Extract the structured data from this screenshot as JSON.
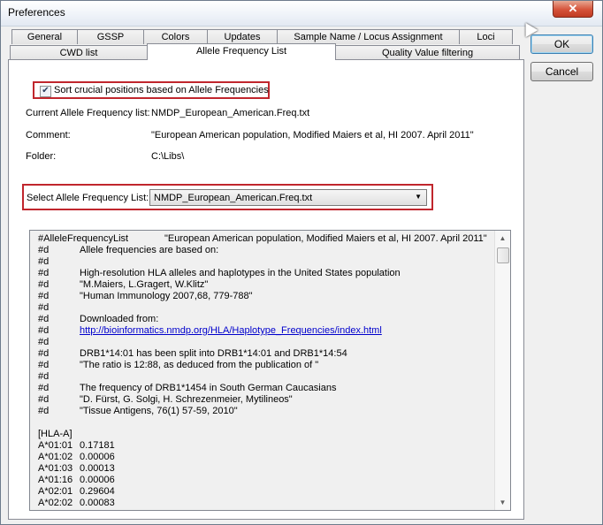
{
  "window": {
    "title": "Preferences",
    "close_glyph": "✕"
  },
  "tabs_row1": [
    "General",
    "GSSP",
    "Colors",
    "Updates",
    "Sample Name / Locus Assignment",
    "Loci"
  ],
  "tabs_row2": [
    "CWD list",
    "Allele Frequency List",
    "Quality Value filtering"
  ],
  "active_tab": "Allele Frequency List",
  "checkbox": {
    "label": "Sort crucial positions based on Allele Frequencies",
    "checked": true,
    "mark": "✔"
  },
  "info": {
    "current_label": "Current Allele Frequency list:",
    "current_value": "NMDP_European_American.Freq.txt",
    "comment_label": "Comment:",
    "comment_value": "\"European American population, Modified Maiers et al, HI 2007. April 2011\"",
    "folder_label": "Folder:",
    "folder_value": "C:\\Libs\\"
  },
  "select": {
    "label": "Select Allele Frequency List:",
    "value": "NMDP_European_American.Freq.txt",
    "arrow": "▼"
  },
  "file_lines": [
    {
      "c1": "#AlleleFrequencyList",
      "c2": "",
      "c3": "\"European American population, Modified Maiers et al, HI 2007. April 2011\""
    },
    {
      "c1": "#d",
      "c2": "Allele frequencies are based on:",
      "c3": ""
    },
    {
      "c1": "#d",
      "c2": "",
      "c3": ""
    },
    {
      "c1": "#d",
      "c2": "High-resolution HLA alleles and haplotypes in the United States population",
      "c3": ""
    },
    {
      "c1": "#d",
      "c2": "\"M.Maiers, L.Gragert, W.Klitz\"",
      "c3": ""
    },
    {
      "c1": "#d",
      "c2": "\"Human Immunology 2007,68, 779-788\"",
      "c3": ""
    },
    {
      "c1": "#d",
      "c2": "",
      "c3": ""
    },
    {
      "c1": "#d",
      "c2": "Downloaded from:",
      "c3": ""
    },
    {
      "c1": "#d",
      "c2": "http://bioinformatics.nmdp.org/HLA/Haplotype_Frequencies/index.html",
      "c3": "",
      "link": true
    },
    {
      "c1": "#d",
      "c2": "",
      "c3": ""
    },
    {
      "c1": "#d",
      "c2": "DRB1*14:01 has been split into DRB1*14:01 and DRB1*14:54",
      "c3": ""
    },
    {
      "c1": "#d",
      "c2": "\"The ratio is 12:88, as deduced from the publication of \"",
      "c3": ""
    },
    {
      "c1": "#d",
      "c2": "",
      "c3": ""
    },
    {
      "c1": "#d",
      "c2": "The frequency of DRB1*1454 in South German Caucasians",
      "c3": ""
    },
    {
      "c1": "#d",
      "c2": "\"D. Fürst, G. Solgi, H. Schrezenmeier, Mytilineos\"",
      "c3": ""
    },
    {
      "c1": "#d",
      "c2": "\"Tissue Antigens, 76(1) 57-59, 2010\"",
      "c3": ""
    },
    {
      "c1": "",
      "c2": "",
      "c3": ""
    },
    {
      "c1": "[HLA-A]",
      "c2": "",
      "c3": ""
    },
    {
      "c1": "A*01:01",
      "c2": "0.17181",
      "c3": ""
    },
    {
      "c1": "A*01:02",
      "c2": "0.00006",
      "c3": ""
    },
    {
      "c1": "A*01:03",
      "c2": "0.00013",
      "c3": ""
    },
    {
      "c1": "A*01:16",
      "c2": "0.00006",
      "c3": ""
    },
    {
      "c1": "A*02:01",
      "c2": "0.29604",
      "c3": ""
    },
    {
      "c1": "A*02:02",
      "c2": "0.00083",
      "c3": ""
    }
  ],
  "scroll_up": "▲",
  "scroll_down": "▼",
  "buttons": {
    "ok": "OK",
    "cancel": "Cancel"
  },
  "colors": {
    "highlight_border": "#c0262d",
    "link": "#0000cc"
  }
}
